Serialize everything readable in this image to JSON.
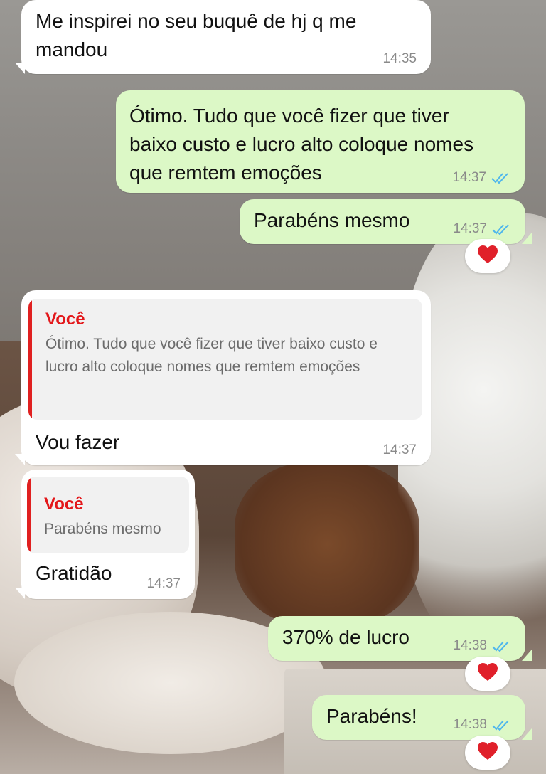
{
  "messages": [
    {
      "text": "Me inspirei no seu buquê de hj q me mandou",
      "time": "14:35"
    },
    {
      "text": "Ótimo. Tudo que você fizer que tiver baixo custo e lucro alto coloque nomes que remtem emoções",
      "time": "14:37"
    },
    {
      "text": "Parabéns mesmo",
      "time": "14:37",
      "reaction": "❤️"
    },
    {
      "quote_author": "Você",
      "quote_text": "Ótimo. Tudo que você fizer que tiver baixo custo e lucro alto coloque nomes que remtem emoções",
      "text": "Vou fazer",
      "time": "14:37"
    },
    {
      "quote_author": "Você",
      "quote_text": "Parabéns mesmo",
      "text": "Gratidão",
      "time": "14:37"
    },
    {
      "text": "370% de lucro",
      "time": "14:38",
      "reaction": "❤️"
    },
    {
      "text": "Parabéns!",
      "time": "14:38",
      "reaction": "❤️"
    }
  ],
  "colors": {
    "incoming_bubble": "#ffffff",
    "outgoing_bubble": "#dcf8c6",
    "quote_author": "#e3181b",
    "read_ticks": "#4fb6ec",
    "heart": "#e0202a"
  },
  "icons": {
    "read_receipt": "double-check-icon",
    "reaction": "heart-icon"
  }
}
